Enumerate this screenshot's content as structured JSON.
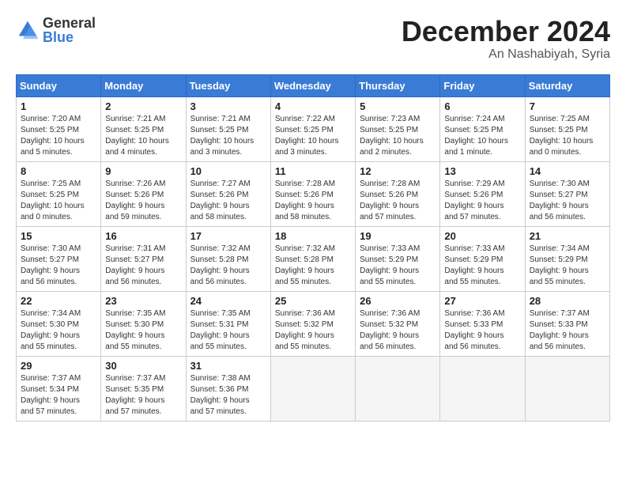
{
  "logo": {
    "general": "General",
    "blue": "Blue"
  },
  "title": "December 2024",
  "location": "An Nashabiyah, Syria",
  "days_of_week": [
    "Sunday",
    "Monday",
    "Tuesday",
    "Wednesday",
    "Thursday",
    "Friday",
    "Saturday"
  ],
  "weeks": [
    [
      {
        "day": "1",
        "info": "Sunrise: 7:20 AM\nSunset: 5:25 PM\nDaylight: 10 hours\nand 5 minutes."
      },
      {
        "day": "2",
        "info": "Sunrise: 7:21 AM\nSunset: 5:25 PM\nDaylight: 10 hours\nand 4 minutes."
      },
      {
        "day": "3",
        "info": "Sunrise: 7:21 AM\nSunset: 5:25 PM\nDaylight: 10 hours\nand 3 minutes."
      },
      {
        "day": "4",
        "info": "Sunrise: 7:22 AM\nSunset: 5:25 PM\nDaylight: 10 hours\nand 3 minutes."
      },
      {
        "day": "5",
        "info": "Sunrise: 7:23 AM\nSunset: 5:25 PM\nDaylight: 10 hours\nand 2 minutes."
      },
      {
        "day": "6",
        "info": "Sunrise: 7:24 AM\nSunset: 5:25 PM\nDaylight: 10 hours\nand 1 minute."
      },
      {
        "day": "7",
        "info": "Sunrise: 7:25 AM\nSunset: 5:25 PM\nDaylight: 10 hours\nand 0 minutes."
      }
    ],
    [
      {
        "day": "8",
        "info": "Sunrise: 7:25 AM\nSunset: 5:25 PM\nDaylight: 10 hours\nand 0 minutes."
      },
      {
        "day": "9",
        "info": "Sunrise: 7:26 AM\nSunset: 5:26 PM\nDaylight: 9 hours\nand 59 minutes."
      },
      {
        "day": "10",
        "info": "Sunrise: 7:27 AM\nSunset: 5:26 PM\nDaylight: 9 hours\nand 58 minutes."
      },
      {
        "day": "11",
        "info": "Sunrise: 7:28 AM\nSunset: 5:26 PM\nDaylight: 9 hours\nand 58 minutes."
      },
      {
        "day": "12",
        "info": "Sunrise: 7:28 AM\nSunset: 5:26 PM\nDaylight: 9 hours\nand 57 minutes."
      },
      {
        "day": "13",
        "info": "Sunrise: 7:29 AM\nSunset: 5:26 PM\nDaylight: 9 hours\nand 57 minutes."
      },
      {
        "day": "14",
        "info": "Sunrise: 7:30 AM\nSunset: 5:27 PM\nDaylight: 9 hours\nand 56 minutes."
      }
    ],
    [
      {
        "day": "15",
        "info": "Sunrise: 7:30 AM\nSunset: 5:27 PM\nDaylight: 9 hours\nand 56 minutes."
      },
      {
        "day": "16",
        "info": "Sunrise: 7:31 AM\nSunset: 5:27 PM\nDaylight: 9 hours\nand 56 minutes."
      },
      {
        "day": "17",
        "info": "Sunrise: 7:32 AM\nSunset: 5:28 PM\nDaylight: 9 hours\nand 56 minutes."
      },
      {
        "day": "18",
        "info": "Sunrise: 7:32 AM\nSunset: 5:28 PM\nDaylight: 9 hours\nand 55 minutes."
      },
      {
        "day": "19",
        "info": "Sunrise: 7:33 AM\nSunset: 5:29 PM\nDaylight: 9 hours\nand 55 minutes."
      },
      {
        "day": "20",
        "info": "Sunrise: 7:33 AM\nSunset: 5:29 PM\nDaylight: 9 hours\nand 55 minutes."
      },
      {
        "day": "21",
        "info": "Sunrise: 7:34 AM\nSunset: 5:29 PM\nDaylight: 9 hours\nand 55 minutes."
      }
    ],
    [
      {
        "day": "22",
        "info": "Sunrise: 7:34 AM\nSunset: 5:30 PM\nDaylight: 9 hours\nand 55 minutes."
      },
      {
        "day": "23",
        "info": "Sunrise: 7:35 AM\nSunset: 5:30 PM\nDaylight: 9 hours\nand 55 minutes."
      },
      {
        "day": "24",
        "info": "Sunrise: 7:35 AM\nSunset: 5:31 PM\nDaylight: 9 hours\nand 55 minutes."
      },
      {
        "day": "25",
        "info": "Sunrise: 7:36 AM\nSunset: 5:32 PM\nDaylight: 9 hours\nand 55 minutes."
      },
      {
        "day": "26",
        "info": "Sunrise: 7:36 AM\nSunset: 5:32 PM\nDaylight: 9 hours\nand 56 minutes."
      },
      {
        "day": "27",
        "info": "Sunrise: 7:36 AM\nSunset: 5:33 PM\nDaylight: 9 hours\nand 56 minutes."
      },
      {
        "day": "28",
        "info": "Sunrise: 7:37 AM\nSunset: 5:33 PM\nDaylight: 9 hours\nand 56 minutes."
      }
    ],
    [
      {
        "day": "29",
        "info": "Sunrise: 7:37 AM\nSunset: 5:34 PM\nDaylight: 9 hours\nand 57 minutes."
      },
      {
        "day": "30",
        "info": "Sunrise: 7:37 AM\nSunset: 5:35 PM\nDaylight: 9 hours\nand 57 minutes."
      },
      {
        "day": "31",
        "info": "Sunrise: 7:38 AM\nSunset: 5:36 PM\nDaylight: 9 hours\nand 57 minutes."
      },
      {
        "day": "",
        "info": ""
      },
      {
        "day": "",
        "info": ""
      },
      {
        "day": "",
        "info": ""
      },
      {
        "day": "",
        "info": ""
      }
    ]
  ]
}
